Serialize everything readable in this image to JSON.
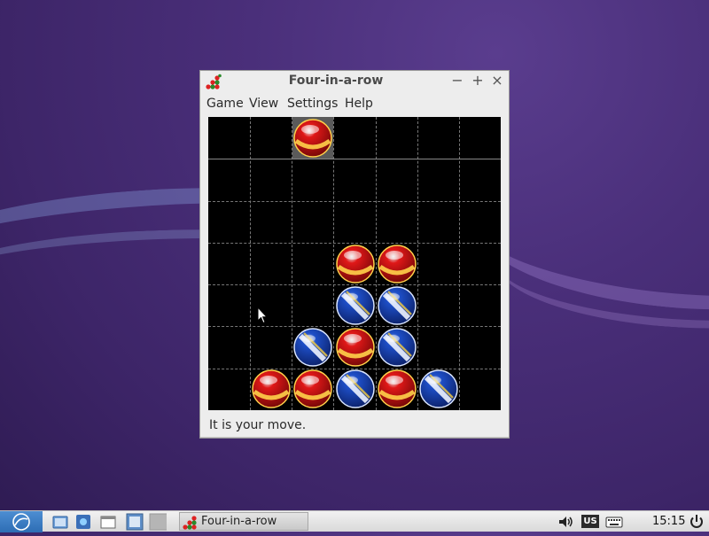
{
  "window": {
    "title": "Four-in-a-row",
    "min_label": "−",
    "max_label": "+",
    "close_label": "×"
  },
  "menu": {
    "items": [
      "Game",
      "View",
      "Settings",
      "Help"
    ]
  },
  "board": {
    "columns": 7,
    "rows": 7,
    "hover_column": 2,
    "player_disc": "red",
    "cells": [
      [
        null,
        null,
        "red",
        null,
        null,
        null,
        null
      ],
      [
        null,
        null,
        null,
        null,
        null,
        null,
        null
      ],
      [
        null,
        null,
        null,
        null,
        null,
        null,
        null
      ],
      [
        null,
        null,
        null,
        "red",
        "red",
        null,
        null
      ],
      [
        null,
        null,
        null,
        "blue",
        "blue",
        null,
        null
      ],
      [
        null,
        null,
        "blue",
        "red",
        "blue",
        null,
        null
      ],
      [
        null,
        "red",
        "red",
        "blue",
        "red",
        "blue",
        null
      ]
    ]
  },
  "status": {
    "text": "It is your move."
  },
  "taskbar": {
    "task_label": "Four-in-a-row",
    "keyboard_layout": "US",
    "clock": "15:15"
  },
  "colors": {
    "red_disc": "#e01818",
    "blue_disc": "#1e4fc8",
    "board_bg": "#000000",
    "desktop": "#4a2f7a"
  }
}
